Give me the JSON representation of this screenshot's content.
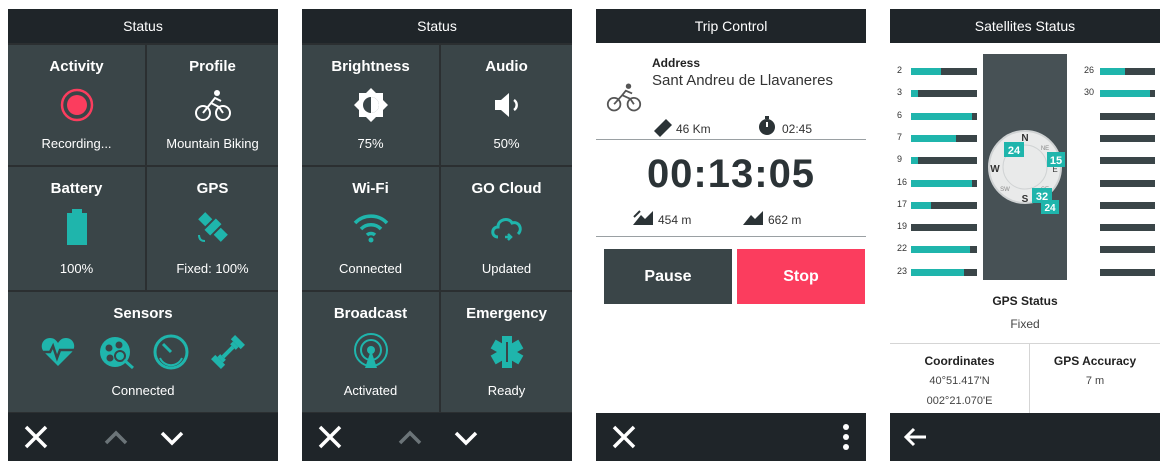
{
  "colors": {
    "accent": "#1fb5ac",
    "record": "#fb3d5e",
    "tile": "#3a4548",
    "bar": "#1f2529"
  },
  "screen1": {
    "title": "Status",
    "activity": {
      "title": "Activity",
      "value": "Recording...",
      "icon": "record-icon"
    },
    "profile": {
      "title": "Profile",
      "value": "Mountain Biking",
      "icon": "bike-icon"
    },
    "battery": {
      "title": "Battery",
      "value": "100%",
      "level": 1.0,
      "icon": "battery-icon"
    },
    "gps": {
      "title": "GPS",
      "value": "Fixed: 100%",
      "icon": "satellite-icon"
    },
    "sensors": {
      "title": "Sensors",
      "value": "Connected",
      "icons": [
        "heart-rate-icon",
        "cadence-icon",
        "speed-sensor-icon",
        "power-icon"
      ]
    }
  },
  "screen2": {
    "title": "Status",
    "brightness": {
      "title": "Brightness",
      "value": "75%",
      "icon": "brightness-icon"
    },
    "audio": {
      "title": "Audio",
      "value": "50%",
      "icon": "volume-icon"
    },
    "wifi": {
      "title": "Wi-Fi",
      "value": "Connected",
      "icon": "wifi-icon"
    },
    "gocloud": {
      "title": "GO Cloud",
      "value": "Updated",
      "icon": "cloud-sync-icon"
    },
    "broadcast": {
      "title": "Broadcast",
      "value": "Activated",
      "icon": "broadcast-icon"
    },
    "emergency": {
      "title": "Emergency",
      "value": "Ready",
      "icon": "emergency-icon"
    }
  },
  "screen3": {
    "title": "Trip Control",
    "address_label": "Address",
    "address_value": "Sant Andreu de Llavaneres",
    "distance": "46 Km",
    "eta": "02:45",
    "timer": "00:13:05",
    "ascent": "454 m",
    "descent": "662 m",
    "pause_label": "Pause",
    "stop_label": "Stop"
  },
  "screen4": {
    "title": "Satellites Status",
    "satellites_left": [
      {
        "id": "2",
        "signal": 0.45
      },
      {
        "id": "3",
        "signal": 0.1
      },
      {
        "id": "6",
        "signal": 0.93
      },
      {
        "id": "7",
        "signal": 0.68
      },
      {
        "id": "9",
        "signal": 0.1
      },
      {
        "id": "16",
        "signal": 0.93
      },
      {
        "id": "17",
        "signal": 0.3
      },
      {
        "id": "19",
        "signal": 0.0
      },
      {
        "id": "22",
        "signal": 0.9
      },
      {
        "id": "23",
        "signal": 0.8
      }
    ],
    "satellites_right": [
      {
        "id": "26",
        "signal": 0.45
      },
      {
        "id": "30",
        "signal": 0.9
      },
      {
        "id": "",
        "signal": 0.0
      },
      {
        "id": "",
        "signal": 0.0
      },
      {
        "id": "",
        "signal": 0.0
      },
      {
        "id": "",
        "signal": 0.0
      },
      {
        "id": "",
        "signal": 0.0
      },
      {
        "id": "",
        "signal": 0.0
      },
      {
        "id": "",
        "signal": 0.0
      },
      {
        "id": "",
        "signal": 0.0
      }
    ],
    "sky_sats": [
      "24",
      "15",
      "32",
      "24"
    ],
    "compass": {
      "n": "N",
      "s": "S",
      "w": "W",
      "e": "E",
      "ne": "NE",
      "se": "SE",
      "sw": "SW"
    },
    "gps_status_label": "GPS Status",
    "gps_status_value": "Fixed",
    "coordinates_label": "Coordinates",
    "latitude": "40°51.417'N",
    "longitude": "002°21.070'E",
    "accuracy_label": "GPS Accuracy",
    "accuracy_value": "7 m"
  }
}
